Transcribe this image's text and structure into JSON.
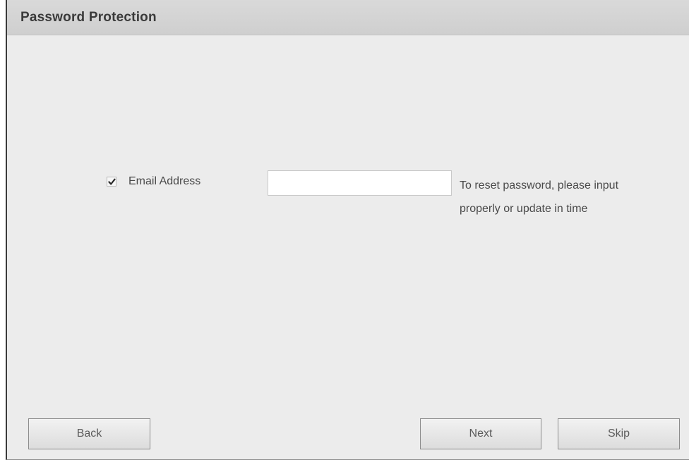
{
  "window": {
    "title": "Password Protection"
  },
  "form": {
    "email_checkbox_checked": true,
    "email_label": "Email Address",
    "email_value": "",
    "hint_line1": "To reset password, please input",
    "hint_line2": "properly or update in time"
  },
  "buttons": {
    "back": "Back",
    "next": "Next",
    "skip": "Skip"
  },
  "icons": {
    "checkbox": "checkmark-icon"
  }
}
